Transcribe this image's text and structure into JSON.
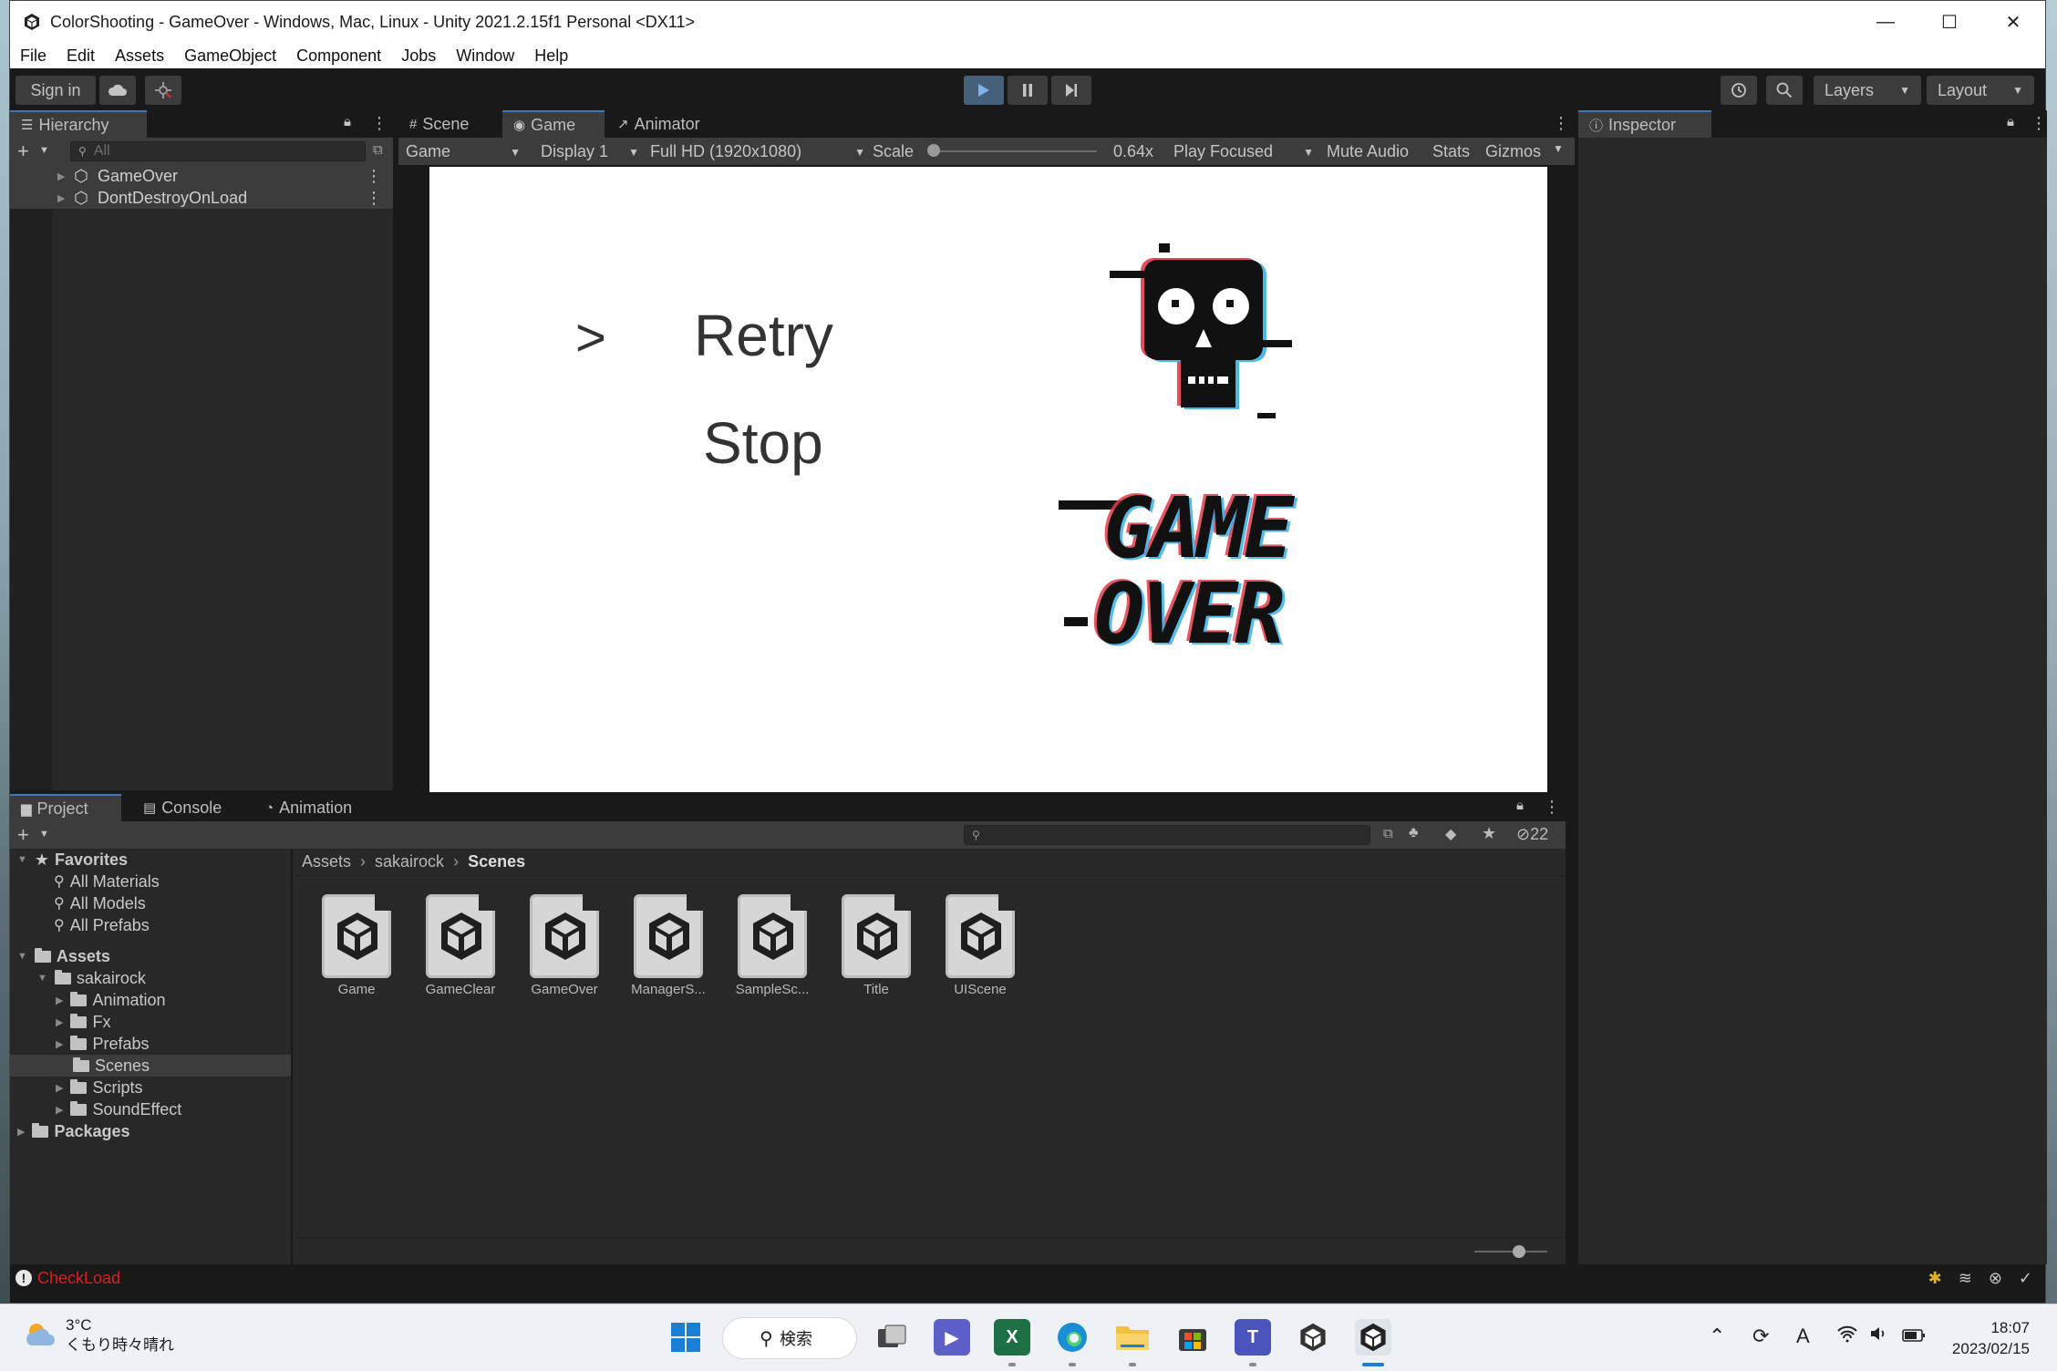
{
  "window": {
    "title": "ColorShooting - GameOver - Windows, Mac, Linux - Unity 2021.2.15f1 Personal <DX11>",
    "controls": {
      "minimize": "—",
      "maximize": "☐",
      "close": "✕"
    }
  },
  "menu": [
    "File",
    "Edit",
    "Assets",
    "GameObject",
    "Component",
    "Jobs",
    "Window",
    "Help"
  ],
  "toolbar": {
    "sign_in": "Sign in",
    "play_state": "playing",
    "layers": "Layers",
    "layout": "Layout"
  },
  "hierarchy": {
    "title": "Hierarchy",
    "search_placeholder": "All",
    "items": [
      {
        "label": "GameOver"
      },
      {
        "label": "DontDestroyOnLoad"
      }
    ]
  },
  "center_tabs": {
    "scene": "Scene",
    "game": "Game",
    "animator": "Animator"
  },
  "game_toolbar": {
    "view": "Game",
    "display": "Display 1",
    "resolution": "Full HD (1920x1080)",
    "scale_label": "Scale",
    "scale_value": "0.64x",
    "scale_fraction": 0.0,
    "play_mode": "Play Focused",
    "mute": "Mute Audio",
    "stats": "Stats",
    "gizmos": "Gizmos"
  },
  "game_screen": {
    "cursor": ">",
    "option_retry": "Retry",
    "option_stop": "Stop",
    "logo_line1": "GAME",
    "logo_line2": "OVER"
  },
  "inspector": {
    "title": "Inspector"
  },
  "bottom_tabs": {
    "project": "Project",
    "console": "Console",
    "animation": "Animation"
  },
  "project": {
    "hidden_count": "22",
    "favorites": {
      "label": "Favorites",
      "items": [
        "All Materials",
        "All Models",
        "All Prefabs"
      ]
    },
    "assets_label": "Assets",
    "sakairock_label": "sakairock",
    "folders": [
      "Animation",
      "Fx",
      "Prefabs",
      "Scenes",
      "Scripts",
      "SoundEffect"
    ],
    "selected_folder": "Scenes",
    "packages_label": "Packages",
    "breadcrumb": [
      "Assets",
      "sakairock",
      "Scenes"
    ],
    "files": [
      "Game",
      "GameClear",
      "GameOver",
      "ManagerS...",
      "SampleSc...",
      "Title",
      "UIScene"
    ]
  },
  "status": {
    "error_text": "CheckLoad"
  },
  "taskbar": {
    "weather_temp": "3°C",
    "weather_desc": "くもり時々晴れ",
    "search_label": "検索",
    "excel_letter": "X",
    "teams_letter": "T",
    "ime": "A",
    "time": "18:07",
    "date": "2023/02/15"
  },
  "colors": {
    "editor_bg": "#191919",
    "panel_bg": "#282828",
    "toolbar_bg": "#3c3c3c",
    "accent": "#3a79bb",
    "error": "#e21b1b"
  }
}
